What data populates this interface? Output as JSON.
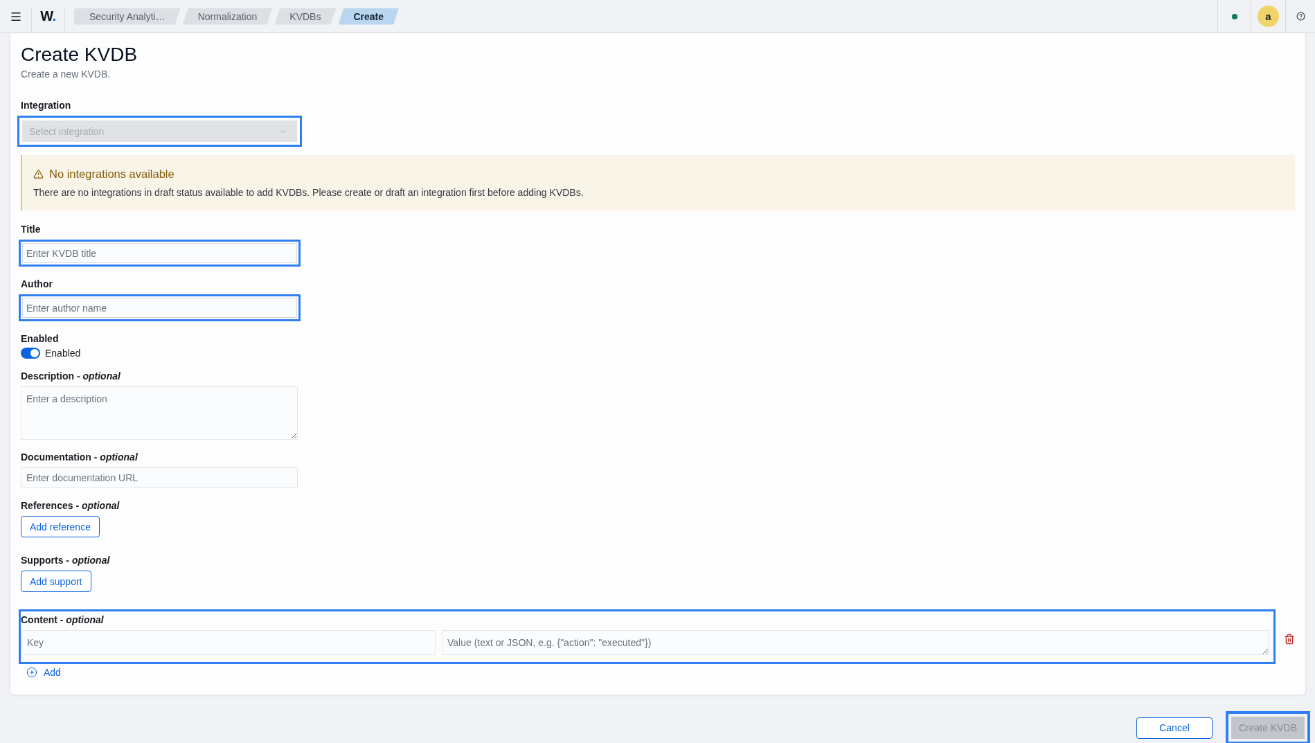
{
  "header": {
    "logo": {
      "letter": "W",
      "dot": "."
    },
    "breadcrumbs": [
      {
        "label": "Security Analyti…",
        "selected": false
      },
      {
        "label": "Normalization",
        "selected": false
      },
      {
        "label": "KVDBs",
        "selected": false
      },
      {
        "label": "Create",
        "selected": true
      }
    ],
    "avatar": "a"
  },
  "page": {
    "title": "Create KVDB",
    "subtitle": "Create a new KVDB."
  },
  "form": [
    {
      "kind": "select",
      "label": "Integration",
      "placeholder": "Select integration",
      "disabled": true,
      "highlighted": true
    },
    {
      "kind": "callout",
      "title": "No integrations available",
      "text": "There are no integrations in draft status available to add KVDBs. Please create or draft an integration first before adding KVDBs."
    },
    {
      "kind": "text",
      "label": "Title",
      "placeholder": "Enter KVDB title",
      "highlighted": true
    },
    {
      "kind": "text",
      "label": "Author",
      "placeholder": "Enter author name",
      "highlighted": true
    },
    {
      "kind": "switch",
      "label": "Enabled",
      "switch_label": "Enabled",
      "on": true
    },
    {
      "kind": "textarea",
      "label": "Description - *optional*",
      "placeholder": "Enter a description",
      "highlighted": false
    },
    {
      "kind": "text",
      "label": "Documentation - *optional*",
      "placeholder": "Enter documentation URL",
      "highlighted": false
    },
    {
      "kind": "button",
      "label": "References - *optional*",
      "button": "Add reference"
    },
    {
      "kind": "button",
      "label": "Supports - *optional*",
      "button": "Add support"
    },
    {
      "kind": "key_value",
      "label": "Content - *optional*",
      "highlighted": true,
      "entries": [
        {
          "key_placeholder": "Key",
          "value_placeholder": "Value (text or JSON, e.g. {\"action\": \"executed\"})"
        }
      ],
      "add_label": "Add"
    }
  ],
  "footer": {
    "buttons": [
      {
        "kind": "secondary",
        "label": "Cancel",
        "disabled": false,
        "highlighted": false
      },
      {
        "kind": "primary",
        "label": "Create KVDB",
        "disabled": true,
        "highlighted": true
      }
    ]
  }
}
